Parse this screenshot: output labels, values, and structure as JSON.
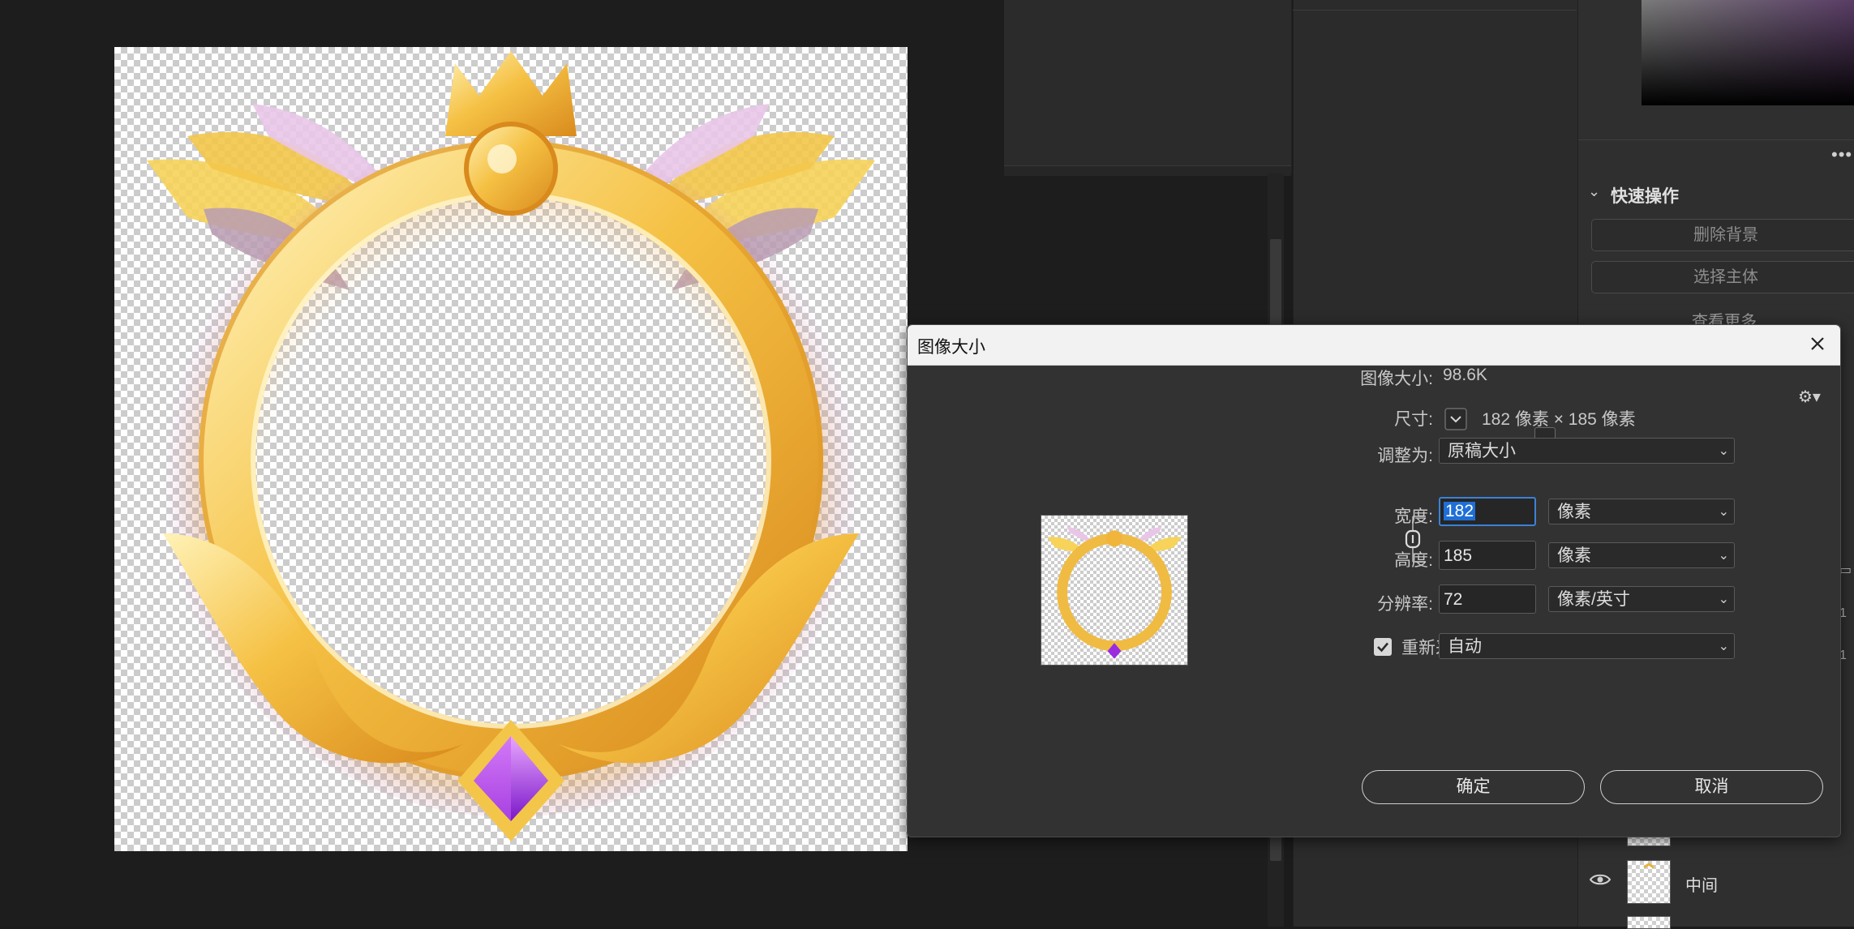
{
  "quick_actions": {
    "title": "快速操作",
    "remove_background": "删除背景",
    "select_subject": "选择主体",
    "view_more": "查看更多"
  },
  "layers": {
    "items": [
      {
        "name": "中间"
      }
    ],
    "side_fragments": [
      "1",
      "1"
    ]
  },
  "dialog": {
    "title": "图像大小",
    "image_size_label": "图像大小:",
    "image_size_value": "98.6K",
    "dimensions_label": "尺寸:",
    "dimensions_value": "182 像素  ×  185 像素",
    "fit_to_label": "调整为:",
    "fit_to_value": "原稿大小",
    "width_label": "宽度:",
    "width_value": "182",
    "width_unit": "像素",
    "height_label": "高度:",
    "height_value": "185",
    "height_unit": "像素",
    "resolution_label": "分辨率:",
    "resolution_value": "72",
    "resolution_unit": "像素/英寸",
    "resample_label": "重新采样(S):",
    "resample_checked": true,
    "resample_value": "自动",
    "ok_label": "确定",
    "cancel_label": "取消"
  },
  "colors": {
    "accent": "#1f6fd6",
    "dialog_bg": "#323232",
    "panel_bg": "#2b2b2b"
  }
}
